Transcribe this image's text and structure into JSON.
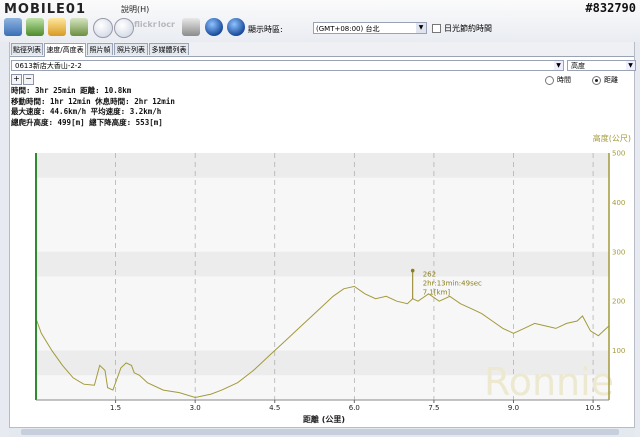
{
  "app": {
    "brand": "MOBILE01",
    "menu_help": "說明(H)",
    "post_id": "#832790"
  },
  "toolbar": {
    "icons": [
      "route-icon",
      "gpx-icon",
      "open-folder-icon",
      "car-icon",
      "clock-icon",
      "camera-icon",
      "flickr-icon",
      "locr-icon",
      "export-icon",
      "google-earth-icon",
      "globe-icon"
    ],
    "flickr_label": "flickr",
    "locr_label": "locr",
    "timezone_label": "顯示時區:",
    "timezone_value": "(GMT+08:00) 台北",
    "dst_label": "日光節約時間"
  },
  "tabs": [
    {
      "label": "點徑列表"
    },
    {
      "label": "速度/高度表",
      "active": true
    },
    {
      "label": "照片幀"
    },
    {
      "label": "照片列表"
    },
    {
      "label": "多媒體列表"
    }
  ],
  "track_select": "0613新店大香山-2-2",
  "metric_select": "高度",
  "axis_mode": {
    "time_label": "時間",
    "distance_label": "距離",
    "selected": "distance"
  },
  "stats": {
    "line1": "時間: 3hr 25min  距離: 10.8km",
    "line2": "移動時間: 1hr 12min  休息時間: 2hr 12min",
    "line3": "最大速度: 44.6km/h  平均速度: 3.2km/h",
    "line4": "總爬升高度: 499[m]  總下降高度: 553[m]"
  },
  "watermark": "Ronnie",
  "colors": {
    "line": "#a39a3c",
    "axis": "#2e8b2e",
    "right_axis": "#a39a3c",
    "band": "#ececec"
  },
  "chart_data": {
    "type": "line",
    "xlabel": "距離 (公里)",
    "ylabel": "高度(公尺)",
    "xlim": [
      0,
      10.8
    ],
    "ylim": [
      0,
      500
    ],
    "xticks": [
      1.5,
      3.0,
      4.5,
      6.0,
      7.5,
      9.0,
      10.5
    ],
    "yticks": [
      100,
      200,
      300,
      400,
      500
    ],
    "x": [
      0,
      0.1,
      0.3,
      0.5,
      0.7,
      0.9,
      1.1,
      1.2,
      1.3,
      1.35,
      1.45,
      1.6,
      1.7,
      1.8,
      1.85,
      1.95,
      2.1,
      2.4,
      2.7,
      3.0,
      3.3,
      3.5,
      3.8,
      4.1,
      4.4,
      4.7,
      5.0,
      5.3,
      5.6,
      5.8,
      6.0,
      6.2,
      6.4,
      6.6,
      6.8,
      7.0,
      7.1,
      7.2,
      7.4,
      7.6,
      7.8,
      8.0,
      8.2,
      8.4,
      8.6,
      8.8,
      9.0,
      9.2,
      9.4,
      9.6,
      9.8,
      10.0,
      10.2,
      10.3,
      10.45,
      10.6,
      10.7,
      10.8
    ],
    "y": [
      165,
      135,
      100,
      70,
      45,
      32,
      30,
      70,
      60,
      25,
      20,
      65,
      75,
      70,
      55,
      50,
      35,
      20,
      15,
      5,
      12,
      20,
      35,
      60,
      90,
      120,
      150,
      180,
      210,
      225,
      230,
      215,
      205,
      210,
      200,
      195,
      205,
      200,
      215,
      200,
      210,
      195,
      185,
      175,
      160,
      145,
      135,
      145,
      155,
      150,
      145,
      155,
      160,
      170,
      140,
      130,
      140,
      150
    ],
    "marker": {
      "x": 7.1,
      "y": 262,
      "label_value": "262",
      "label_time": "2hr:13min:49sec",
      "label_dist": "7.1[km]"
    }
  }
}
